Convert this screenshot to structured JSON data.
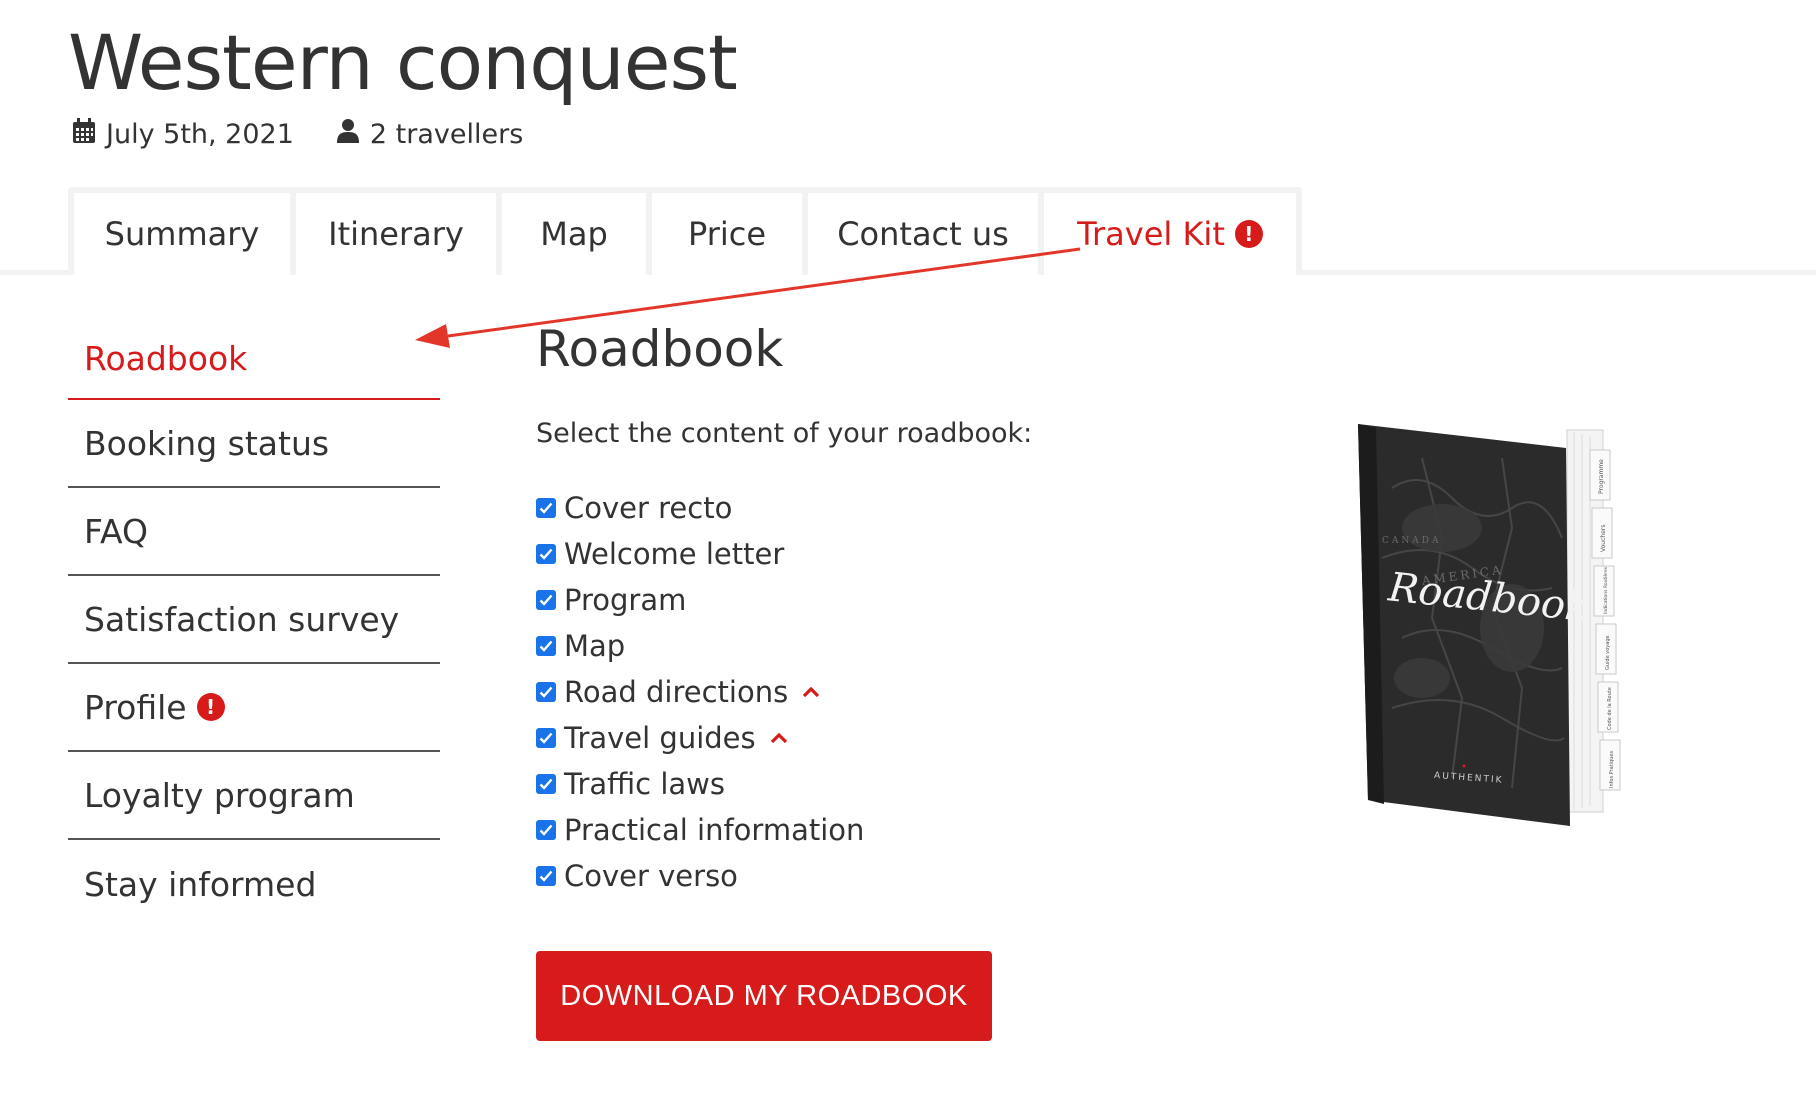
{
  "header": {
    "title": "Western conquest",
    "date": "July 5th, 2021",
    "travellers": "2 travellers"
  },
  "tabs": [
    {
      "label": "Summary"
    },
    {
      "label": "Itinerary"
    },
    {
      "label": "Map"
    },
    {
      "label": "Price"
    },
    {
      "label": "Contact us"
    },
    {
      "label": "Travel Kit",
      "active": true,
      "alert": "!"
    }
  ],
  "sidebar": {
    "items": [
      {
        "label": "Roadbook",
        "active": true
      },
      {
        "label": "Booking status"
      },
      {
        "label": "FAQ"
      },
      {
        "label": "Satisfaction survey"
      },
      {
        "label": "Profile",
        "alert": "!"
      },
      {
        "label": "Loyalty program"
      },
      {
        "label": "Stay informed"
      }
    ]
  },
  "main": {
    "heading": "Roadbook",
    "intro": "Select the content of your roadbook:",
    "options": [
      {
        "label": "Cover recto",
        "checked": true
      },
      {
        "label": "Welcome letter",
        "checked": true
      },
      {
        "label": "Program",
        "checked": true
      },
      {
        "label": "Map",
        "checked": true
      },
      {
        "label": "Road directions",
        "checked": true,
        "expandable": true
      },
      {
        "label": "Travel guides",
        "checked": true,
        "expandable": true
      },
      {
        "label": "Traffic laws",
        "checked": true
      },
      {
        "label": "Practical information",
        "checked": true
      },
      {
        "label": "Cover verso",
        "checked": true
      }
    ],
    "download_label": "DOWNLOAD MY ROADBOOK"
  },
  "book": {
    "cover_title": "Roadbook",
    "brand": "AUTHENTIK",
    "map_text": [
      "AMERICA",
      "CANADA"
    ],
    "tab_labels": [
      "Programme",
      "Vouchers",
      "Indications Routières",
      "Guide voyage",
      "Code de la Route",
      "Infos Pratiques"
    ]
  },
  "colors": {
    "accent": "#d71a1a",
    "checkbox": "#1a73e8",
    "text": "#333333",
    "tab_bg": "#f2f2f2"
  }
}
